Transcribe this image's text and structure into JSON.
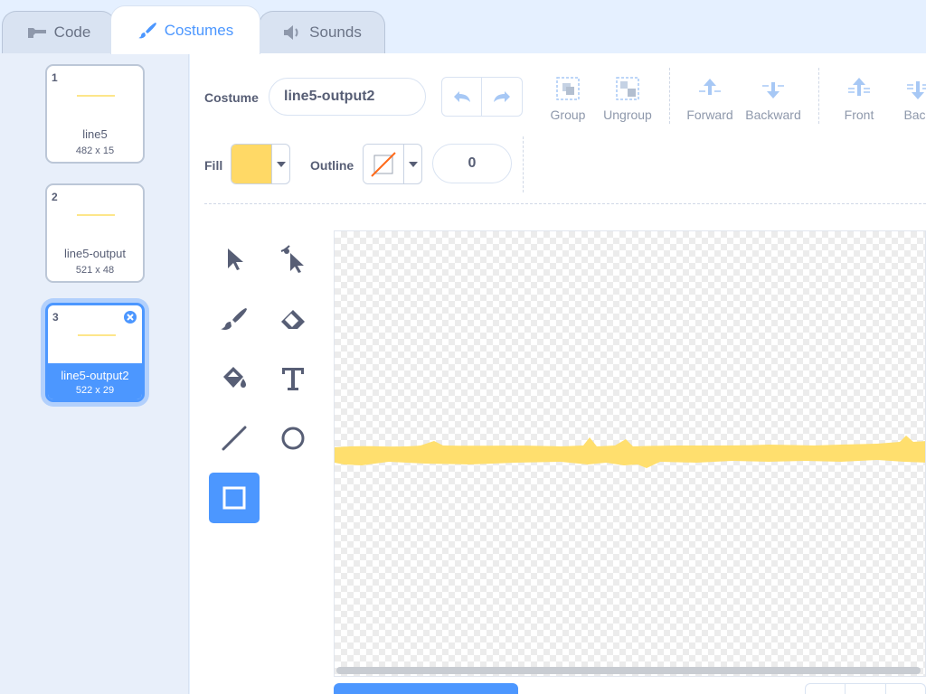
{
  "tabs": {
    "code": "Code",
    "costumes": "Costumes",
    "sounds": "Sounds"
  },
  "costumes": [
    {
      "number": "1",
      "name": "line5",
      "size": "482 x 15"
    },
    {
      "number": "2",
      "name": "line5-output",
      "size": "521 x 48"
    },
    {
      "number": "3",
      "name": "line5-output2",
      "size": "522 x 29",
      "selected": true
    }
  ],
  "toolbar": {
    "costume_label": "Costume",
    "costume_name": "line5-output2",
    "group": "Group",
    "ungroup": "Ungroup",
    "forward": "Forward",
    "backward": "Backward",
    "front": "Front",
    "back": "Back",
    "fill_label": "Fill",
    "outline_label": "Outline",
    "outline_width": "0"
  },
  "colors": {
    "accent": "#4c97ff",
    "fill": "#ffd966",
    "outline_none_slash": "#ff6a1a",
    "stroke_shape": "#ffdf6e"
  },
  "tools": [
    {
      "icon": "select-icon"
    },
    {
      "icon": "reshape-icon"
    },
    {
      "icon": "brush-icon"
    },
    {
      "icon": "eraser-icon"
    },
    {
      "icon": "fill-icon"
    },
    {
      "icon": "text-icon"
    },
    {
      "icon": "line-icon"
    },
    {
      "icon": "circle-icon"
    },
    {
      "icon": "rectangle-icon",
      "active": true
    }
  ]
}
